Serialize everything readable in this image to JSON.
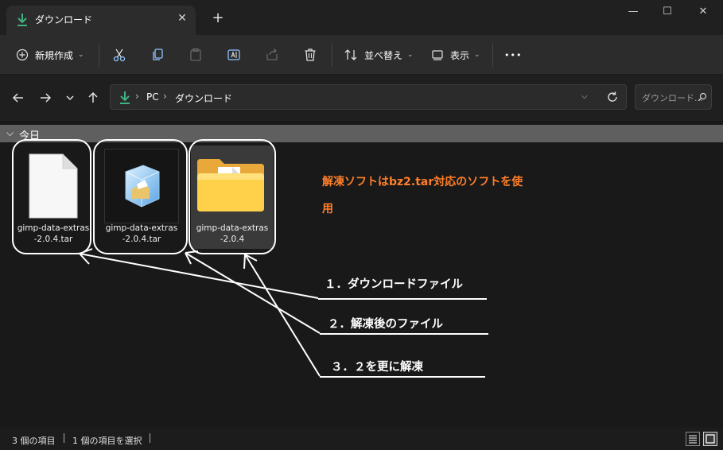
{
  "window": {
    "tab_title": "ダウンロード",
    "tab_close": "✕",
    "new_tab": "+",
    "minimize": "—",
    "maximize": "☐",
    "close": "✕"
  },
  "toolbar": {
    "new_label": "新規作成",
    "sort_label": "並べ替え",
    "view_label": "表示",
    "more_label": "•••"
  },
  "address": {
    "crumbs": [
      "PC",
      "ダウンロード"
    ],
    "crumb_sep": "›",
    "search_placeholder": "ダウンロード..."
  },
  "group": {
    "chevron": "⌵",
    "label": "今日"
  },
  "files": [
    {
      "name_line1": "gimp-data-extras",
      "name_line2": "-2.0.4.tar",
      "icon": "document-icon"
    },
    {
      "name_line1": "gimp-data-extras",
      "name_line2": "-2.0.4.tar",
      "icon": "archive-icon"
    },
    {
      "name_line1": "gimp-data-extras",
      "name_line2": "-2.0.4",
      "icon": "folder-icon"
    }
  ],
  "annotations": {
    "note_line1": "解凍ソフトはbz2.tar対応のソフトを使",
    "note_line2": "用",
    "label1": "１．ダウンロードファイル",
    "label2": "２．解凍後のファイル",
    "label3": "３．２を更に解凍"
  },
  "status": {
    "item_count": "3 個の項目",
    "selected": "1 個の項目を選択"
  },
  "colors": {
    "accent_green": "#3fb27f",
    "note_orange": "#ff7f2a"
  }
}
